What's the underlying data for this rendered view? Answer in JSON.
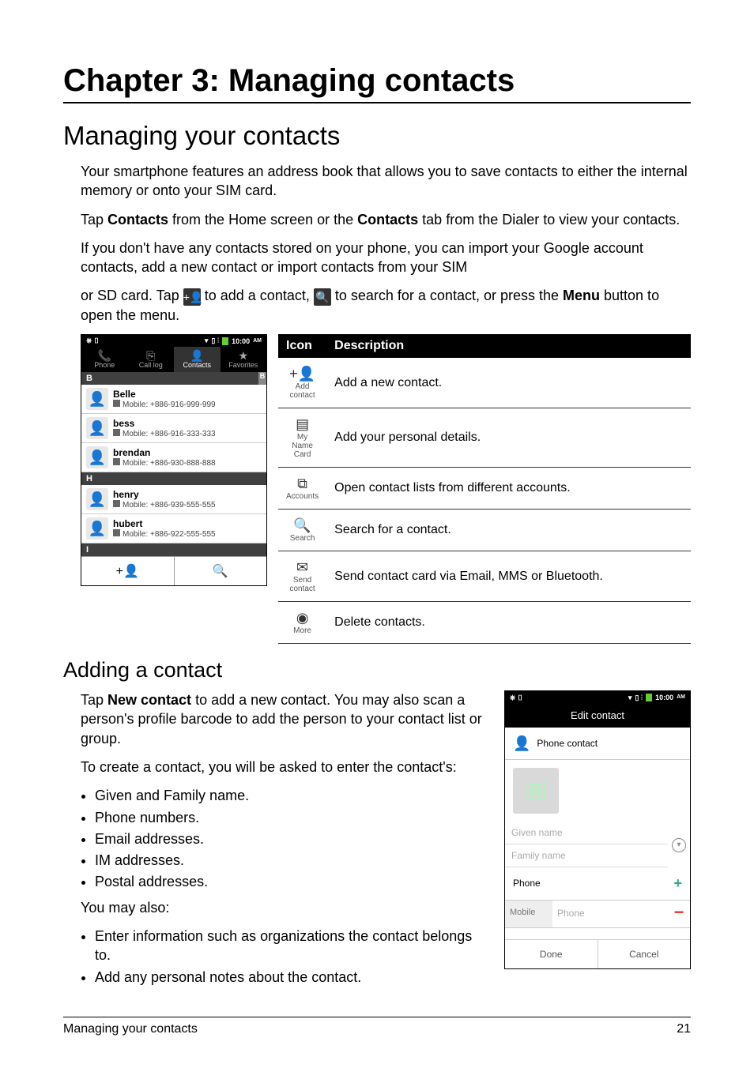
{
  "chapter_title": "Chapter 3: Managing contacts",
  "section_title": "Managing your contacts",
  "intro": {
    "p1": "Your smartphone features an address book that allows you to save contacts to either the internal memory or onto your SIM card.",
    "p2a": "Tap ",
    "p2b": "Contacts",
    "p2c": " from the Home screen or the ",
    "p2d": "Contacts",
    "p2e": " tab from the Dialer to view your contacts.",
    "p3": "If you don't have any contacts stored on your phone, you can import your Google account contacts, add a new contact or import contacts from your SIM",
    "p4a": "or SD card. Tap ",
    "p4b": " to add a contact, ",
    "p4c": " to search for a contact, or press the ",
    "p4d": "Menu",
    "p4e": " button to open the menu."
  },
  "phone1": {
    "time": "10:00",
    "am": "AM",
    "tabs": {
      "phone": "Phone",
      "calllog": "Call log",
      "contacts": "Contacts",
      "favorites": "Favorites"
    },
    "letters": {
      "b": "B",
      "h": "H",
      "i": "I"
    },
    "contacts": [
      {
        "name": "Belle",
        "num": "Mobile: +886-916-999-999"
      },
      {
        "name": "bess",
        "num": "Mobile: +886-916-333-333"
      },
      {
        "name": "brendan",
        "num": "Mobile: +886-930-888-888"
      },
      {
        "name": "henry",
        "num": "Mobile: +886-939-555-555"
      },
      {
        "name": "hubert",
        "num": "Mobile: +886-922-555-555"
      }
    ]
  },
  "icon_table": {
    "h_icon": "Icon",
    "h_desc": "Description",
    "rows": [
      {
        "label": "Add contact",
        "glyph": "+👤",
        "desc": "Add a new contact."
      },
      {
        "label": "My Name Card",
        "glyph": "▤",
        "desc": "Add your personal details."
      },
      {
        "label": "Accounts",
        "glyph": "⧉",
        "desc": "Open contact lists from different accounts."
      },
      {
        "label": "Search",
        "glyph": "🔍",
        "desc": "Search for a contact."
      },
      {
        "label": "Send contact",
        "glyph": "✉",
        "desc": "Send contact card via Email, MMS or Bluetooth."
      },
      {
        "label": "More",
        "glyph": "◉",
        "desc": "Delete contacts."
      }
    ]
  },
  "adding": {
    "title": "Adding a contact",
    "p1a": "Tap ",
    "p1b": "New contact",
    "p1c": " to add a new contact. You may also scan a person's profile barcode to add the person to your contact list or group.",
    "p2": "To create a contact, you will be asked to enter the contact's:",
    "bullets1": [
      "Given and Family name.",
      "Phone numbers.",
      "Email addresses.",
      "IM addresses.",
      "Postal addresses."
    ],
    "p3": "You may also:",
    "bullets2": [
      "Enter information such as organizations the contact belongs to.",
      "Add any personal notes about the contact."
    ]
  },
  "phone2": {
    "time": "10:00",
    "am": "AM",
    "title": "Edit contact",
    "type": "Phone contact",
    "given_ph": "Given name",
    "family_ph": "Family name",
    "phone_label": "Phone",
    "mobile_label": "Mobile",
    "phone_ph": "Phone",
    "done": "Done",
    "cancel": "Cancel"
  },
  "footer": {
    "left": "Managing your contacts",
    "right": "21"
  }
}
